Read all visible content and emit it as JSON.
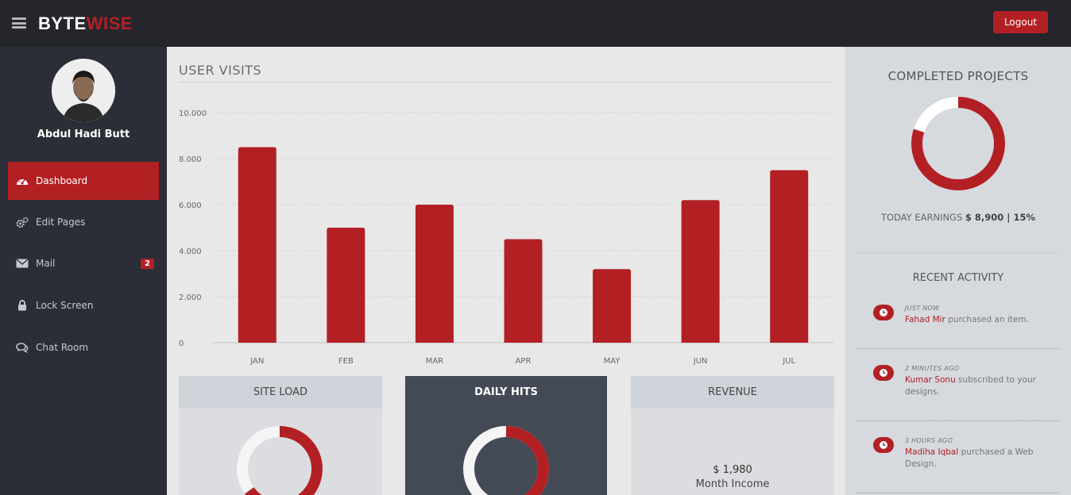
{
  "brand": {
    "part1": "BYTE",
    "part2": "WISE"
  },
  "header": {
    "logout_label": "Logout"
  },
  "profile": {
    "name": "Abdul Hadi Butt"
  },
  "sidebar": {
    "items": [
      {
        "label": "Dashboard",
        "icon": "dashboard-icon"
      },
      {
        "label": "Edit Pages",
        "icon": "gears-icon"
      },
      {
        "label": "Mail",
        "icon": "envelope-icon",
        "badge": "2"
      },
      {
        "label": "Lock Screen",
        "icon": "lock-icon"
      },
      {
        "label": "Chat Room",
        "icon": "chat-icon"
      }
    ]
  },
  "main": {
    "section_title": "USER VISITS"
  },
  "chart_data": {
    "type": "bar",
    "categories": [
      "JAN",
      "FEB",
      "MAR",
      "APR",
      "MAY",
      "JUN",
      "JUL"
    ],
    "values": [
      8500,
      5000,
      6000,
      4500,
      3200,
      6200,
      7500
    ],
    "ylim": [
      0,
      10000
    ],
    "yticks": [
      "0",
      "2.000",
      "4.000",
      "6.000",
      "8.000",
      "10.000"
    ],
    "ytick_values": [
      0,
      2000,
      4000,
      6000,
      8000,
      10000
    ],
    "color": "#b22024",
    "grid": true
  },
  "cards": {
    "site_load": {
      "title": "SITE LOAD",
      "percent": 65
    },
    "daily_hits": {
      "title": "DAILY HITS",
      "percent": 55
    },
    "revenue": {
      "title": "REVENUE",
      "value": "$ 1,980",
      "label": "Month Income"
    }
  },
  "right": {
    "projects_title": "COMPLETED PROJECTS",
    "projects_percent": 80,
    "earnings_label": "TODAY EARNINGS",
    "earnings_value": "$ 8,900 | 15%",
    "activity_title": "RECENT ACTIVITY",
    "activity": [
      {
        "time": "JUST NOW",
        "who": "Fahad Mir",
        "text": " purchased an item."
      },
      {
        "time": "2 MINUTES AGO",
        "who": "Kumar Sonu",
        "text": " subscribed to your designs."
      },
      {
        "time": "3 HOURS AGO",
        "who": "Madiha Iqbal",
        "text": " purchased a Web Design."
      }
    ]
  },
  "colors": {
    "accent": "#b22024",
    "topbar": "#24262c",
    "sidebar": "#2b2e36",
    "dark_card": "#434a55"
  }
}
